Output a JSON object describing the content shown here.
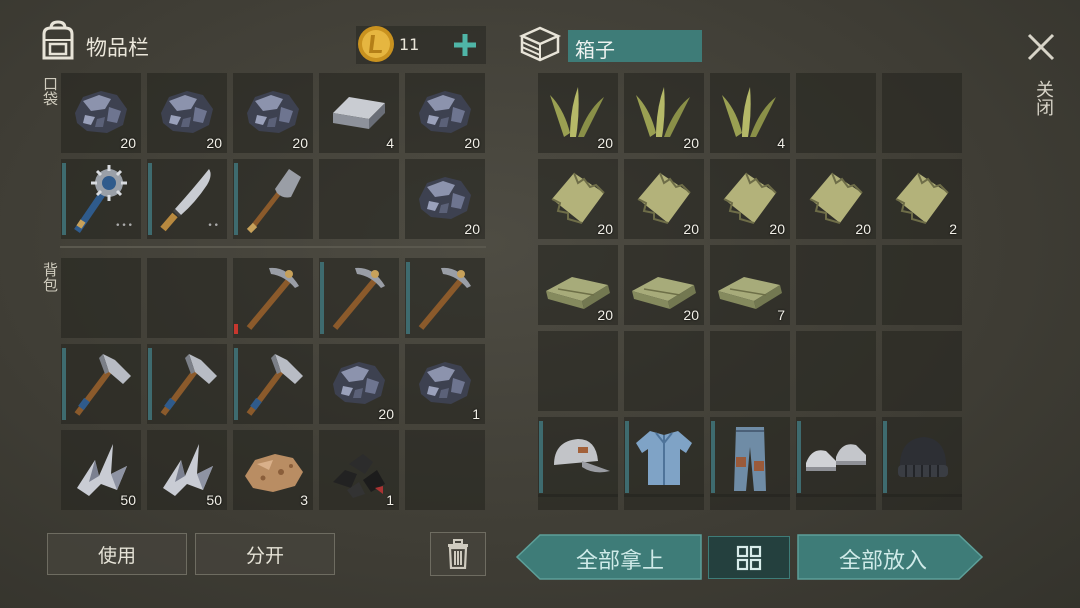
{
  "inventory": {
    "title": "物品栏",
    "coins": "11",
    "pocket_label": "口袋",
    "backpack_label": "背包",
    "pocket_slots": [
      {
        "item": "ore-stone",
        "qty": "20"
      },
      {
        "item": "ore-stone",
        "qty": "20"
      },
      {
        "item": "ore-stone",
        "qty": "20"
      },
      {
        "item": "iron-bar",
        "qty": "4"
      },
      {
        "item": "ore-stone",
        "qty": "20"
      },
      {
        "item": "spiked-club",
        "qty": "",
        "dots": "•••"
      },
      {
        "item": "machete",
        "qty": "",
        "dots": "••"
      },
      {
        "item": "shovel",
        "qty": ""
      },
      {
        "item": "",
        "qty": ""
      },
      {
        "item": "ore-stone",
        "qty": "20"
      }
    ],
    "backpack_slots": [
      {
        "item": "",
        "qty": ""
      },
      {
        "item": "",
        "qty": ""
      },
      {
        "item": "pickaxe",
        "qty": ""
      },
      {
        "item": "pickaxe",
        "qty": ""
      },
      {
        "item": "pickaxe",
        "qty": ""
      },
      {
        "item": "hatchet",
        "qty": ""
      },
      {
        "item": "hatchet",
        "qty": ""
      },
      {
        "item": "hatchet",
        "qty": ""
      },
      {
        "item": "ore-stone",
        "qty": "20"
      },
      {
        "item": "ore-stone",
        "qty": "1"
      },
      {
        "item": "metal-scrap",
        "qty": "50"
      },
      {
        "item": "metal-scrap",
        "qty": "50"
      },
      {
        "item": "copper-ore",
        "qty": "3"
      },
      {
        "item": "coal",
        "qty": "1"
      },
      {
        "item": "",
        "qty": ""
      }
    ],
    "use_label": "使用",
    "split_label": "分开"
  },
  "box": {
    "title": "箱子",
    "close_label": "关闭",
    "take_all_label": "全部拿上",
    "put_all_label": "全部放入",
    "slots": [
      {
        "item": "plant-fiber",
        "qty": "20"
      },
      {
        "item": "plant-fiber",
        "qty": "20"
      },
      {
        "item": "plant-fiber",
        "qty": "4"
      },
      {
        "item": "",
        "qty": ""
      },
      {
        "item": "",
        "qty": ""
      },
      {
        "item": "rag",
        "qty": "20"
      },
      {
        "item": "rag",
        "qty": "20"
      },
      {
        "item": "rag",
        "qty": "20"
      },
      {
        "item": "rag",
        "qty": "20"
      },
      {
        "item": "rag",
        "qty": "2"
      },
      {
        "item": "cloth",
        "qty": "20"
      },
      {
        "item": "cloth",
        "qty": "20"
      },
      {
        "item": "cloth",
        "qty": "7"
      },
      {
        "item": "",
        "qty": ""
      },
      {
        "item": "",
        "qty": ""
      },
      {
        "item": "",
        "qty": ""
      },
      {
        "item": "",
        "qty": ""
      },
      {
        "item": "",
        "qty": ""
      },
      {
        "item": "",
        "qty": ""
      },
      {
        "item": "",
        "qty": ""
      },
      {
        "item": "cap",
        "qty": ""
      },
      {
        "item": "denim-shirt",
        "qty": ""
      },
      {
        "item": "jeans",
        "qty": ""
      },
      {
        "item": "sneakers",
        "qty": ""
      },
      {
        "item": "beanie",
        "qty": ""
      }
    ]
  },
  "colors": {
    "accent_teal": "#3e7c78",
    "coin": "#d9a62b",
    "plus": "#4fb5a7"
  }
}
